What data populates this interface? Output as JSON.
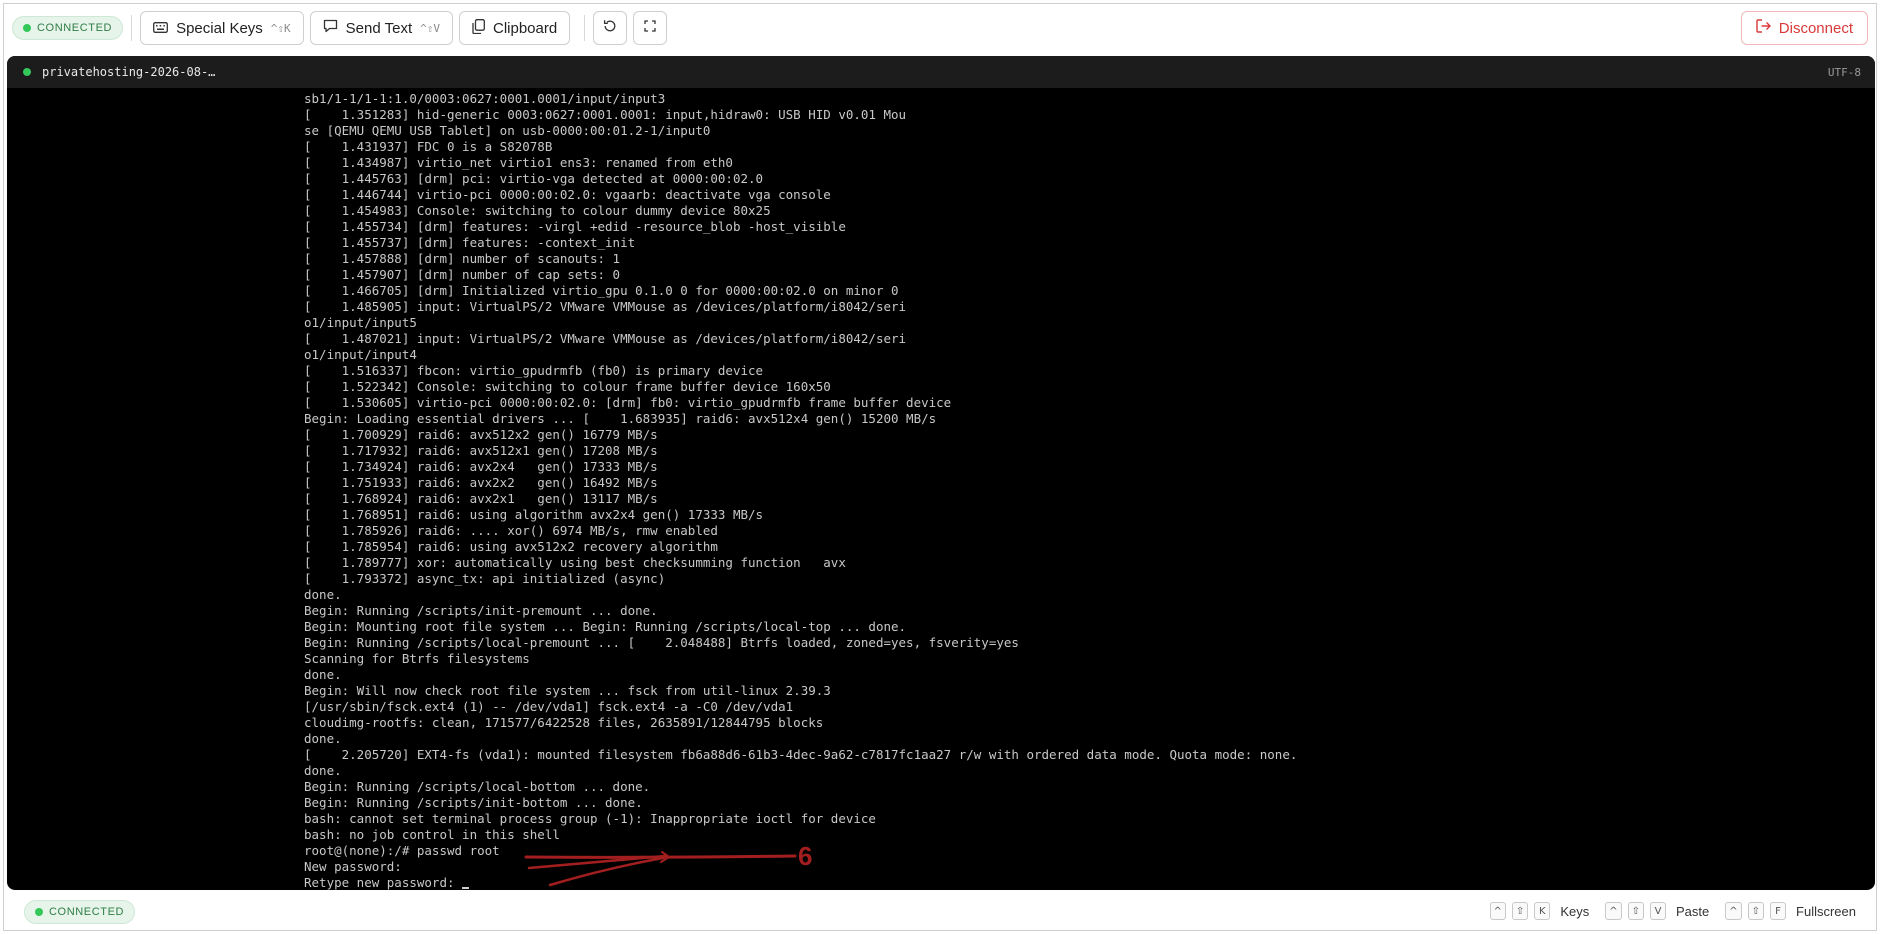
{
  "toolbar": {
    "status": "CONNECTED",
    "special_keys_label": "Special Keys",
    "special_keys_shortcut": "^⇧K",
    "send_text_label": "Send Text",
    "send_text_shortcut": "^⇧V",
    "clipboard_label": "Clipboard",
    "disconnect_label": "Disconnect"
  },
  "terminal": {
    "title": "privatehosting-2026-08-…",
    "encoding": "UTF-8",
    "lines": [
      "sb1/1-1/1-1:1.0/0003:0627:0001.0001/input/input3",
      "[    1.351283] hid-generic 0003:0627:0001.0001: input,hidraw0: USB HID v0.01 Mou",
      "se [QEMU QEMU USB Tablet] on usb-0000:00:01.2-1/input0",
      "[    1.431937] FDC 0 is a S82078B",
      "[    1.434987] virtio_net virtio1 ens3: renamed from eth0",
      "[    1.445763] [drm] pci: virtio-vga detected at 0000:00:02.0",
      "[    1.446744] virtio-pci 0000:00:02.0: vgaarb: deactivate vga console",
      "[    1.454983] Console: switching to colour dummy device 80x25",
      "[    1.455734] [drm] features: -virgl +edid -resource_blob -host_visible",
      "[    1.455737] [drm] features: -context_init",
      "[    1.457888] [drm] number of scanouts: 1",
      "[    1.457907] [drm] number of cap sets: 0",
      "[    1.466705] [drm] Initialized virtio_gpu 0.1.0 0 for 0000:00:02.0 on minor 0",
      "[    1.485905] input: VirtualPS/2 VMware VMMouse as /devices/platform/i8042/seri",
      "o1/input/input5",
      "[    1.487021] input: VirtualPS/2 VMware VMMouse as /devices/platform/i8042/seri",
      "o1/input/input4",
      "[    1.516337] fbcon: virtio_gpudrmfb (fb0) is primary device",
      "[    1.522342] Console: switching to colour frame buffer device 160x50",
      "[    1.530605] virtio-pci 0000:00:02.0: [drm] fb0: virtio_gpudrmfb frame buffer device",
      "Begin: Loading essential drivers ... [    1.683935] raid6: avx512x4 gen() 15200 MB/s",
      "[    1.700929] raid6: avx512x2 gen() 16779 MB/s",
      "[    1.717932] raid6: avx512x1 gen() 17208 MB/s",
      "[    1.734924] raid6: avx2x4   gen() 17333 MB/s",
      "[    1.751933] raid6: avx2x2   gen() 16492 MB/s",
      "[    1.768924] raid6: avx2x1   gen() 13117 MB/s",
      "[    1.768951] raid6: using algorithm avx2x4 gen() 17333 MB/s",
      "[    1.785926] raid6: .... xor() 6974 MB/s, rmw enabled",
      "[    1.785954] raid6: using avx512x2 recovery algorithm",
      "[    1.789777] xor: automatically using best checksumming function   avx",
      "[    1.793372] async_tx: api initialized (async)",
      "done.",
      "Begin: Running /scripts/init-premount ... done.",
      "Begin: Mounting root file system ... Begin: Running /scripts/local-top ... done.",
      "Begin: Running /scripts/local-premount ... [    2.048488] Btrfs loaded, zoned=yes, fsverity=yes",
      "Scanning for Btrfs filesystems",
      "done.",
      "Begin: Will now check root file system ... fsck from util-linux 2.39.3",
      "[/usr/sbin/fsck.ext4 (1) -- /dev/vda1] fsck.ext4 -a -C0 /dev/vda1",
      "cloudimg-rootfs: clean, 171577/6422528 files, 2635891/12844795 blocks",
      "done.",
      "[    2.205720] EXT4-fs (vda1): mounted filesystem fb6a88d6-61b3-4dec-9a62-c7817fc1aa27 r/w with ordered data mode. Quota mode: none.",
      "done.",
      "Begin: Running /scripts/local-bottom ... done.",
      "Begin: Running /scripts/init-bottom ... done.",
      "bash: cannot set terminal process group (-1): Inappropriate ioctl for device",
      "bash: no job control in this shell",
      "root@(none):/# passwd root",
      "New password:",
      "Retype new password: "
    ],
    "annotation_number": "6"
  },
  "statusbar": {
    "status": "CONNECTED",
    "shortcut_keys_label": "Keys",
    "shortcut_paste_label": "Paste",
    "shortcut_fullscreen_label": "Fullscreen",
    "key_ctrl": "^",
    "key_shift": "⇧",
    "key_k": "K",
    "key_v": "V",
    "key_f": "F"
  },
  "colors": {
    "connected_green": "#34c759",
    "disconnect_red": "#d93a3a",
    "annotation_red": "#a31f1f",
    "terminal_bg": "#000000"
  }
}
